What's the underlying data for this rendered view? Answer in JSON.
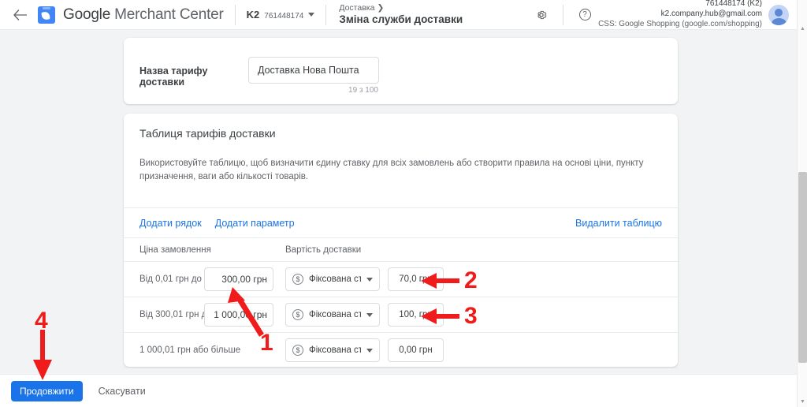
{
  "header": {
    "back_icon": "back-arrow-icon",
    "logo_icon": "google-merchant-center-logo",
    "brand_bold": "Google",
    "brand_thin": " Merchant Center",
    "account_name": "K2",
    "account_id": "761448174",
    "breadcrumb_parent": "Доставка",
    "breadcrumb_chevron": "❯",
    "page_title": "Зміна служби доставки",
    "settings_icon": "gear-icon",
    "help_icon": "help-icon",
    "account_line1": "761448174 (K2)",
    "account_line2": "k2.company.hub@gmail.com",
    "account_line3": "CSS: Google Shopping (google.com/shopping)",
    "avatar_icon": "user-avatar"
  },
  "name_card": {
    "label": "Назва тарифу доставки",
    "value": "Доставка Нова Пошта",
    "placeholder": "Назва тарифу доставки",
    "counter": "19 з 100"
  },
  "table_card": {
    "title": "Таблиця тарифів доставки",
    "description": "Використовуйте таблицю, щоб визначити єдину ставку для всіх замовлень або створити правила на основі ціни, пункту призначення, ваги або кількості товарів.",
    "add_row_label": "Додати рядок",
    "add_param_label": "Додати параметр",
    "delete_table_label": "Видалити таблицю",
    "col_price": "Ціна замовлення",
    "col_cost": "Вартість доставки",
    "rows": [
      {
        "condition_label": "Від 0,01 грн до",
        "price_value": "300,00 грн",
        "rate_type": "Фіксована ста…",
        "rate_icon": "dollar-circle-icon",
        "amount_value": "70,0 грн"
      },
      {
        "condition_label": "Від 300,01 грн до",
        "price_value": "1 000,00 грн",
        "rate_type": "Фіксована ста…",
        "rate_icon": "dollar-circle-icon",
        "amount_value": "100, грн"
      },
      {
        "condition_label": "1 000,01 грн або більше",
        "price_value": "",
        "rate_type": "Фіксована ста…",
        "rate_icon": "dollar-circle-icon",
        "amount_value": "0,00 грн"
      }
    ]
  },
  "footer": {
    "continue_label": "Продовжити",
    "cancel_label": "Скасувати"
  },
  "scrollbar": {
    "up_icon": "scroll-up-arrow",
    "down_icon": "scroll-down-arrow"
  },
  "annotations": {
    "accent_color": "#f01b1b",
    "markers": [
      {
        "id": "1",
        "label": "1",
        "points_to": "row-2-price-input"
      },
      {
        "id": "2",
        "label": "2",
        "points_to": "row-2-amount-input"
      },
      {
        "id": "3",
        "label": "3",
        "points_to": "row-3-amount-input"
      },
      {
        "id": "4",
        "label": "4",
        "points_to": "continue-button"
      }
    ]
  }
}
